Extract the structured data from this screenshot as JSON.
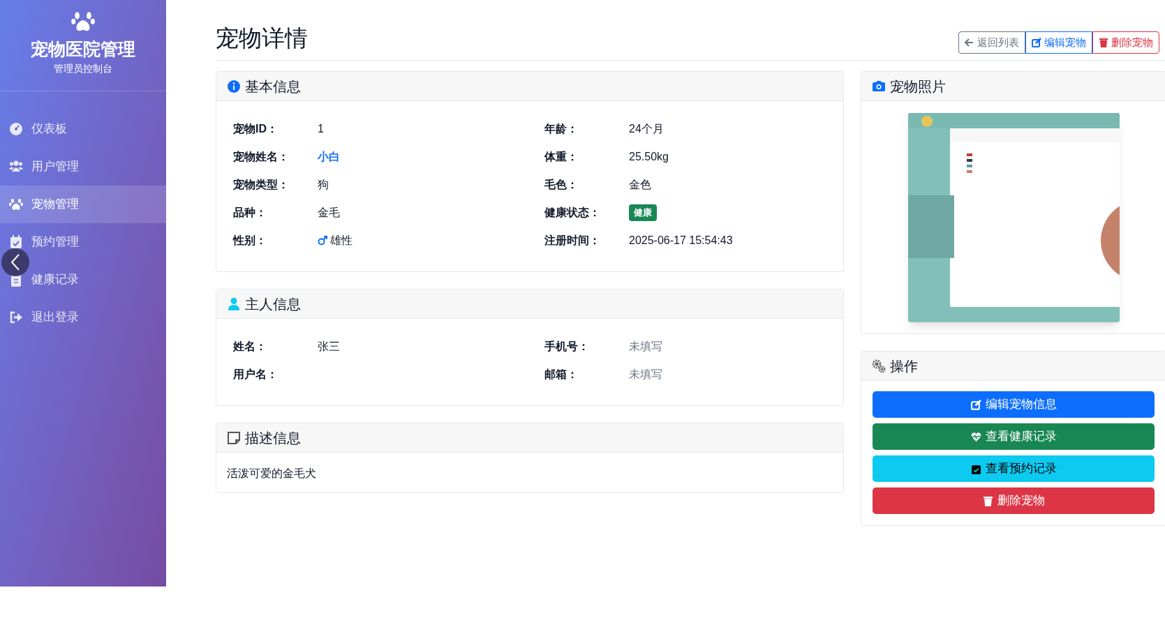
{
  "sidebar": {
    "title": "宠物医院管理",
    "subtitle": "管理员控制台",
    "items": [
      {
        "label": "仪表板",
        "selected": false
      },
      {
        "label": "用户管理",
        "selected": false
      },
      {
        "label": "宠物管理",
        "selected": true
      },
      {
        "label": "预约管理",
        "selected": false
      },
      {
        "label": "健康记录",
        "selected": false
      },
      {
        "label": "退出登录",
        "selected": false
      }
    ]
  },
  "header": {
    "title": "宠物详情",
    "actions": [
      {
        "label": "返回列表",
        "kind": "back"
      },
      {
        "label": "编辑宠物",
        "kind": "edit"
      },
      {
        "label": "删除宠物",
        "kind": "delete"
      }
    ]
  },
  "basic_info": {
    "title": "基本信息",
    "fields": [
      {
        "label": "宠物ID：",
        "value": "1",
        "kind": "text"
      },
      {
        "label": "年龄：",
        "value": "24个月",
        "kind": "text"
      },
      {
        "label": "宠物姓名：",
        "value": "小白",
        "kind": "name"
      },
      {
        "label": "体重：",
        "value": "25.50kg",
        "kind": "text"
      },
      {
        "label": "宠物类型：",
        "value": "狗",
        "kind": "text"
      },
      {
        "label": "毛色：",
        "value": "金色",
        "kind": "text"
      },
      {
        "label": "品种：",
        "value": "金毛",
        "kind": "text"
      },
      {
        "label": "健康状态：",
        "value": "健康",
        "kind": "badge"
      },
      {
        "label": "性别：",
        "value": "雄性",
        "kind": "male"
      },
      {
        "label": "注册时间：",
        "value": "2025-06-17 15:54:43",
        "kind": "text"
      }
    ]
  },
  "owner_info": {
    "title": "主人信息",
    "fields": [
      {
        "label": "姓名：",
        "value": "张三",
        "kind": "text"
      },
      {
        "label": "手机号：",
        "value": "未填写",
        "kind": "missing"
      },
      {
        "label": "用户名："
      },
      {
        "label": "邮箱：",
        "value": "未填写",
        "kind": "missing"
      }
    ]
  },
  "description": {
    "title": "描述信息",
    "text": "活泼可爱的金毛犬"
  },
  "photo": {
    "title": "宠物照片",
    "kind": "picture"
  },
  "operations": {
    "title": "操作",
    "buttons": [
      {
        "label": "编辑宠物信息",
        "kind": "edit"
      },
      {
        "label": "查看健康记录",
        "kind": "health"
      },
      {
        "label": "查看预约记录",
        "kind": "appointments"
      },
      {
        "label": "删除宠物",
        "kind": "delete"
      }
    ]
  }
}
